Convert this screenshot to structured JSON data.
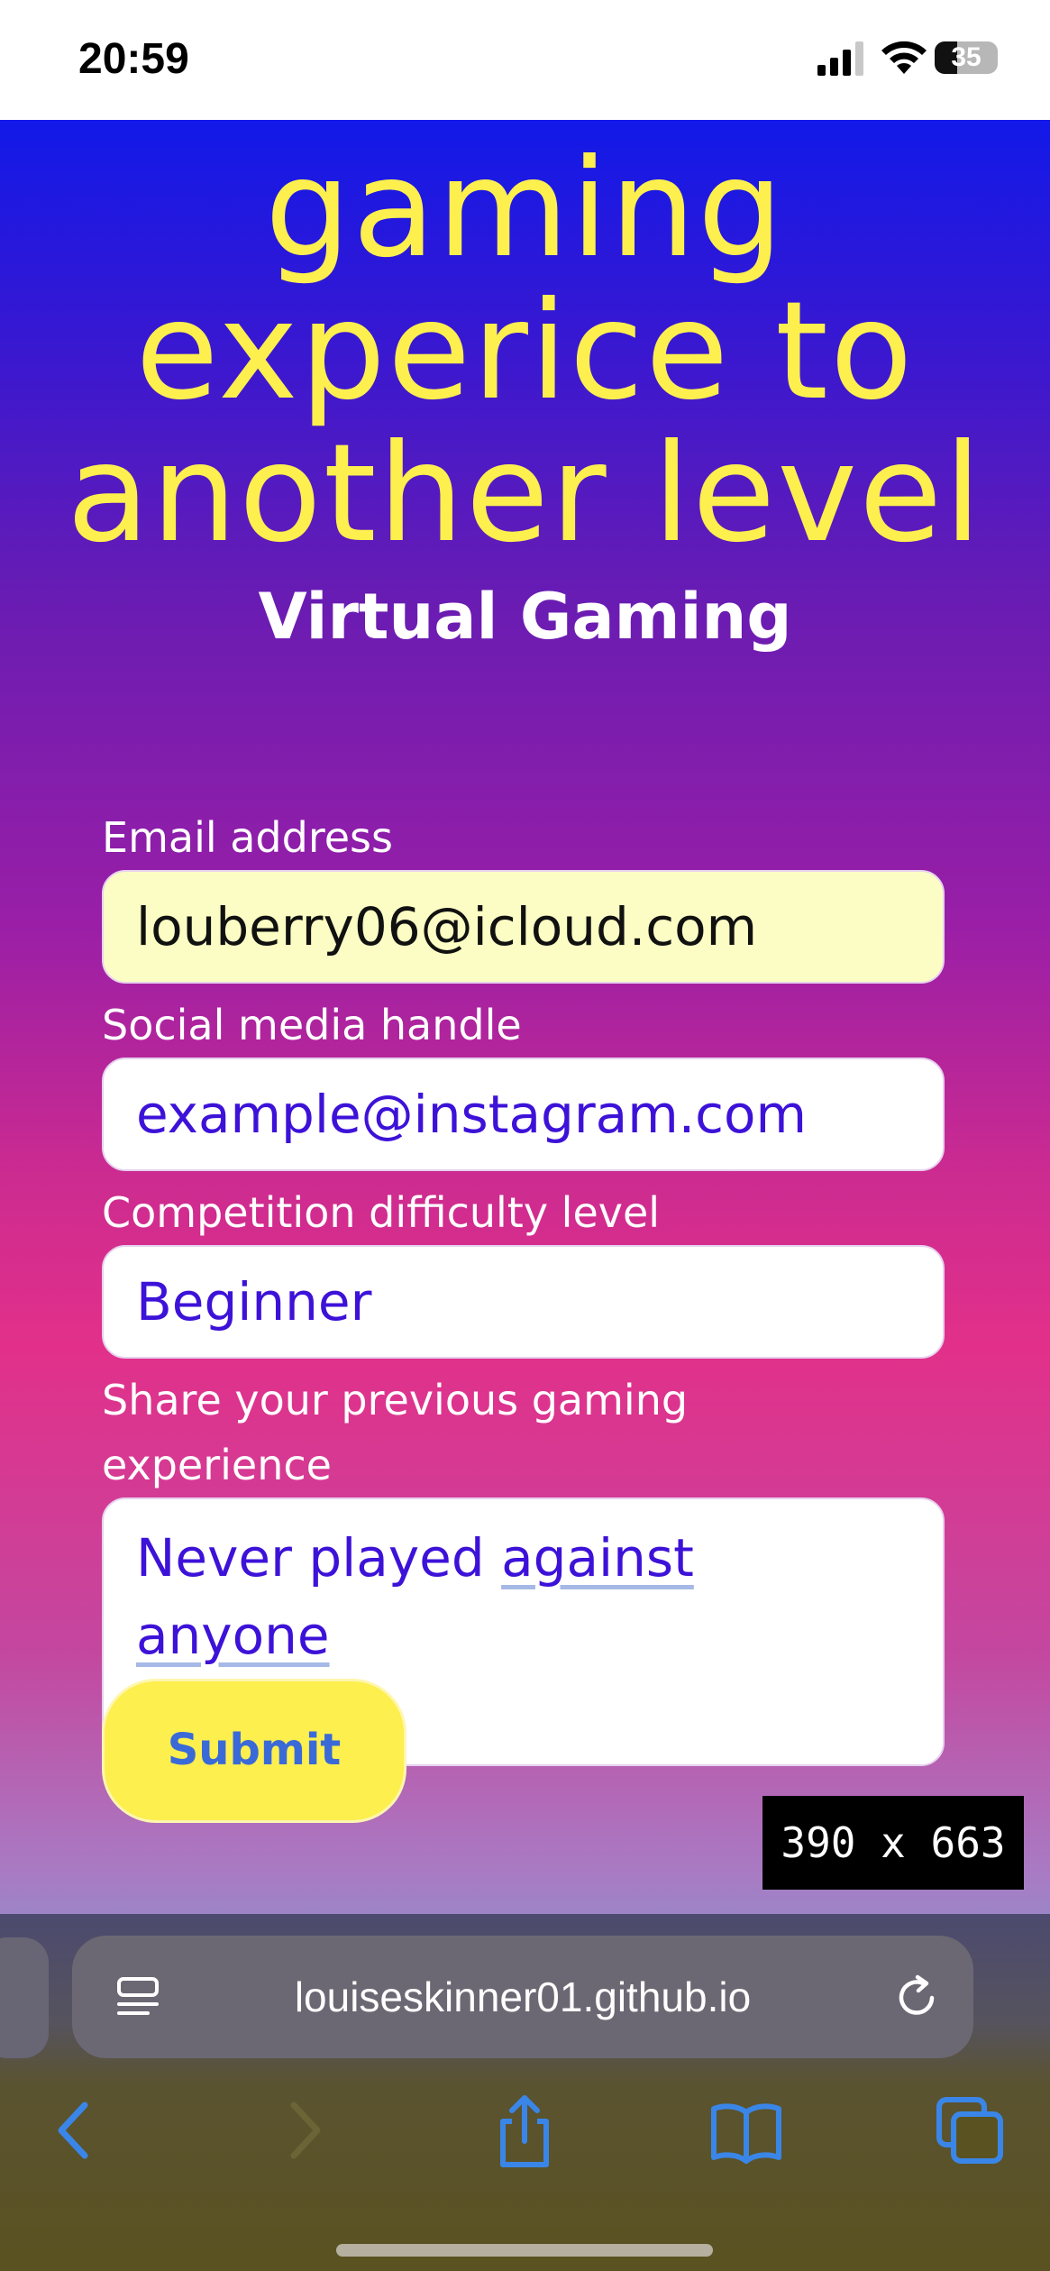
{
  "status_bar": {
    "time": "20:59",
    "battery_level": "35",
    "battery_fraction": 0.35,
    "icons": [
      "signal-icon",
      "wifi-icon",
      "battery-icon"
    ]
  },
  "hero": {
    "title_lines": [
      "gaming",
      "experice to",
      "another level"
    ],
    "subtitle": "Virtual Gaming",
    "title_color": "#fcef4e"
  },
  "form": {
    "email_label": "Email address",
    "email_value": "louberry06@icloud.com",
    "social_label": "Social media handle",
    "social_value": "example@instagram.com",
    "difficulty_label": "Competition difficulty level",
    "difficulty_value": "Beginner",
    "experience_label_line1": "Share your previous gaming",
    "experience_label_line2": "experience",
    "experience_value_part1": "Never played ",
    "experience_value_misspelled1": "against",
    "experience_value_misspelled2": "anyone",
    "submit_label": "Submit"
  },
  "viewport_badge": "390 x 663",
  "browser": {
    "url": "louiseskinner01.github.io",
    "toolbar_icons": [
      "back-icon",
      "forward-icon",
      "share-icon",
      "bookmarks-icon",
      "tabs-icon"
    ],
    "accent_color": "#3a86e8"
  }
}
